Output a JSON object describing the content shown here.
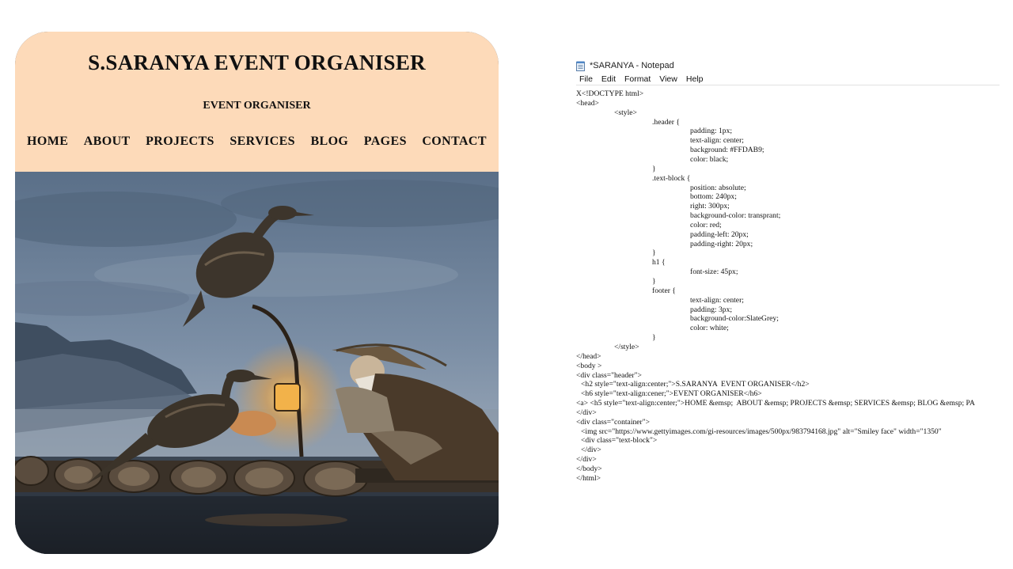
{
  "website": {
    "title": "S.SARANYA EVENT ORGANISER",
    "subtitle": "EVENT ORGANISER",
    "nav": [
      "HOME",
      "ABOUT",
      "PROJECTS",
      "SERVICES",
      "BLOG",
      "PAGES",
      "CONTACT"
    ],
    "header_color": "#FDDAB9"
  },
  "notepad": {
    "title": "*SARANYA - Notepad",
    "menu": [
      "File",
      "Edit",
      "Format",
      "View",
      "Help"
    ],
    "lines": [
      "X<!DOCTYPE html>",
      "<head>",
      "<style>",
      ".header {",
      "padding: 1px;",
      "text-align: center;",
      "background: #FFDAB9;",
      "color: black;",
      "}",
      ".text-block {",
      "position: absolute;",
      "bottom: 240px;",
      "right: 300px;",
      "background-color: transprant;",
      "color: red;",
      "padding-left: 20px;",
      "padding-right: 20px;",
      "}",
      "h1 {",
      "font-size: 45px;",
      "}",
      "footer {",
      "text-align: center;",
      "padding: 3px;",
      "background-color:SlateGrey;",
      "color: white;",
      "}",
      "</style>",
      "</head>",
      "<body >",
      "<div class=\"header\">",
      "<h2 style=\"text-align:center;\">S.SARANYA  EVENT ORGANISER</h2>",
      "<h6 style=\"text-align:cener;\">EVENT ORGANISER</h6>",
      "<a> <h5 style=\"text-align:center;\">HOME &emsp;  ABOUT &emsp; PROJECTS &emsp; SERVICES &emsp; BLOG &emsp; PA",
      "</div>",
      "<div class=\"container\">",
      "<img src=\"https://www.gettyimages.com/gi-resources/images/500px/983794168.jpg\" alt=\"Smiley face\" width=\"1350\"",
      "<div class=\"text-block\">",
      "</div>",
      "</div>",
      "</body>",
      "</html>"
    ]
  }
}
